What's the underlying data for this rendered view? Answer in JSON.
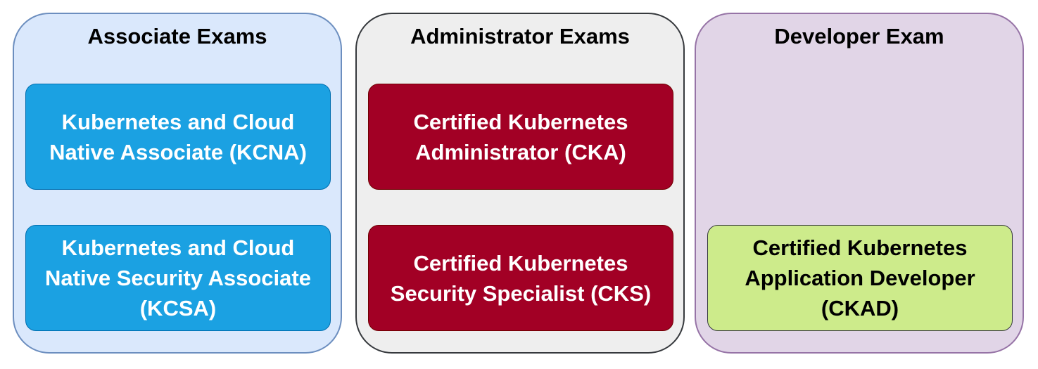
{
  "colors": {
    "associate_group_fill": "#dae8fc",
    "associate_group_border": "#6c8ebf",
    "administrator_group_fill": "#eeeeee",
    "administrator_group_border": "#36393d",
    "developer_group_fill": "#e1d5e7",
    "developer_group_border": "#9673a6",
    "associate_exam_fill": "#1ba1e2",
    "associate_exam_border": "#006eaf",
    "associate_exam_text": "#ffffff",
    "administrator_exam_fill": "#a20025",
    "administrator_exam_border": "#6f0000",
    "administrator_exam_text": "#ffffff",
    "developer_exam_fill": "#cdeb8b",
    "developer_exam_border": "#36393d",
    "developer_exam_text": "#000000"
  },
  "groups": {
    "associate": {
      "title": "Associate Exams",
      "exams": [
        {
          "label": "Kubernetes and Cloud\nNative Associate (KCNA)"
        },
        {
          "label": "Kubernetes and Cloud\nNative Security Associate\n(KCSA)"
        }
      ]
    },
    "administrator": {
      "title": "Administrator Exams",
      "exams": [
        {
          "label": "Certified Kubernetes\nAdministrator (CKA)"
        },
        {
          "label": "Certified Kubernetes\nSecurity Specialist (CKS)"
        }
      ]
    },
    "developer": {
      "title": "Developer Exam",
      "exams": [
        {
          "label": "Certified Kubernetes\nApplication Developer\n(CKAD)"
        }
      ]
    }
  }
}
